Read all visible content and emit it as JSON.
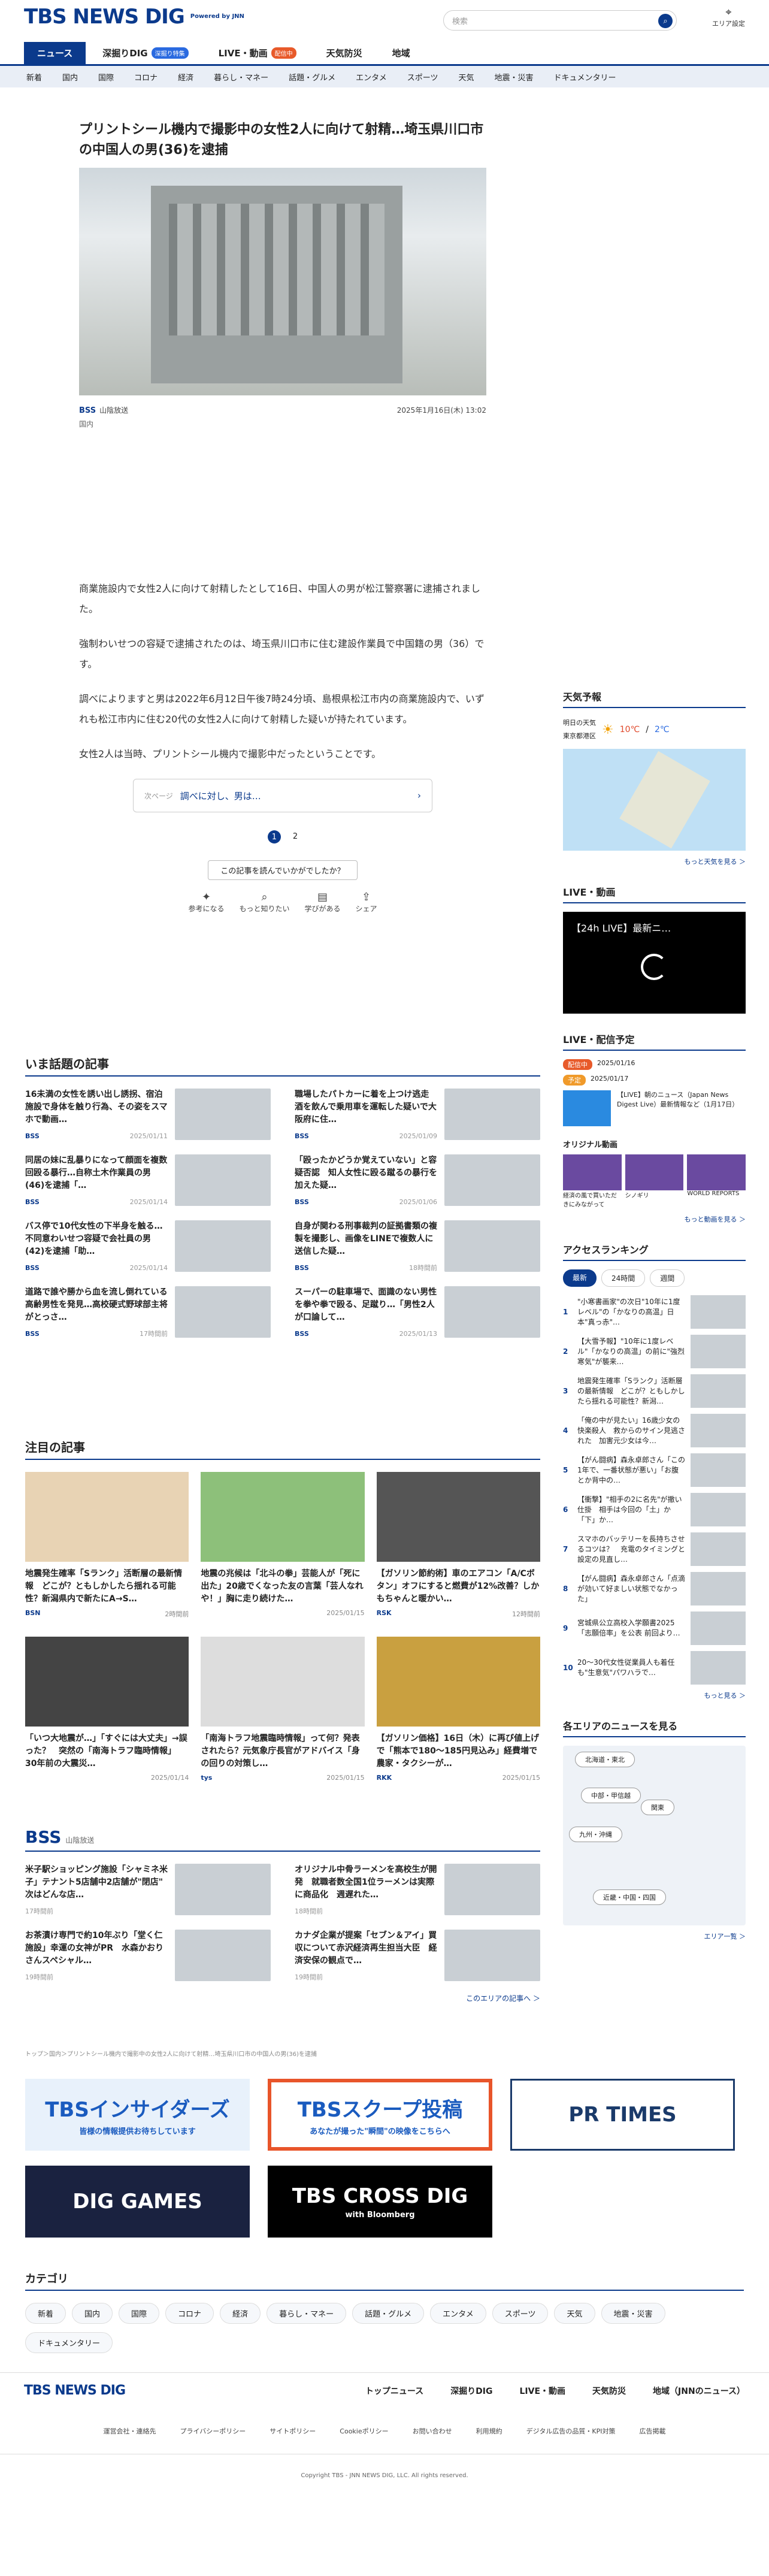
{
  "header": {
    "logo": "TBS NEWS DIG",
    "powered": "Powered by JNN",
    "search_placeholder": "検索",
    "area_label": "エリア設定"
  },
  "mainnav": [
    {
      "label": "ニュース",
      "badge": ""
    },
    {
      "label": "深掘りDIG",
      "badge": "深掘り特集"
    },
    {
      "label": "LIVE・動画",
      "badge": "配信中"
    },
    {
      "label": "天気防災",
      "badge": ""
    },
    {
      "label": "地域",
      "badge": ""
    }
  ],
  "subnav": [
    "新着",
    "国内",
    "国際",
    "コロナ",
    "経済",
    "暮らし・マネー",
    "話題・グルメ",
    "エンタメ",
    "スポーツ",
    "天気",
    "地震・災害",
    "ドキュメンタリー"
  ],
  "article": {
    "title": "プリントシール機内で撮影中の女性2人に向けて射精…埼玉県川口市の中国人の男(36)を逮捕",
    "source": "BSS",
    "source_name": "山陰放送",
    "date": "2025年1月16日(木) 13:02",
    "category": "国内",
    "paragraphs": [
      "商業施設内で女性2人に向けて射精したとして16日、中国人の男が松江警察署に逮捕されました。",
      "強制わいせつの容疑で逮捕されたのは、埼玉県川口市に住む建設作業員で中国籍の男（36）です。",
      "調べによりますと男は2022年6月12日午後7時24分頃、島根県松江市内の商業施設内で、いずれも松江市内に住む20代の女性2人に向けて射精した疑いが持たれています。",
      "女性2人は当時、プリントシール機内で撮影中だったということです。"
    ],
    "next_label": "次ページ",
    "next_text": "調べに対し、男は…",
    "pages": [
      "1",
      "2"
    ]
  },
  "feedback": {
    "question": "この記事を読んでいかがでしたか？",
    "options": [
      "参考になる",
      "もっと知りたい",
      "学びがある",
      "シェア"
    ]
  },
  "hot": {
    "heading": "いま話題の記事",
    "items": [
      {
        "title": "16未満の女性を誘い出し誘拐、宿泊施設で身体を触り行為、その姿をスマホで動画…",
        "src": "BSS",
        "date": "2025/01/11"
      },
      {
        "title": "職場したパトカーに着を上つけ逃走　酒を飲んで乗用車を運転した疑いで大阪府に住…",
        "src": "BSS",
        "date": "2025/01/09"
      },
      {
        "title": "同居の妹に乱暴りになって顔面を複数回殴る暴行…自称土木作業員の男(46)を逮捕「…",
        "src": "BSS",
        "date": "2025/01/14"
      },
      {
        "title": "「殴ったかどうか覚えていない」と容疑否認　知人女性に殴る蹴るの暴行を加えた疑…",
        "src": "BSS",
        "date": "2025/01/06"
      },
      {
        "title": "バス停で10代女性の下半身を触る…不同意わいせつ容疑で会社員の男(42)を逮捕「助…",
        "src": "BSS",
        "date": "2025/01/14"
      },
      {
        "title": "自身が関わる刑事裁判の証拠書類の複製を撮影し、画像をLINEで複数人に送信した疑…",
        "src": "BSS",
        "date": "18時間前"
      },
      {
        "title": "道路で誰や勝から血を流し倒れている高齢男性を発見…高校硬式野球部主将がとっさ…",
        "src": "BSS",
        "date": "17時間前"
      },
      {
        "title": "スーパーの駐車場で、面識のない男性を拳や拳で殴る、足蹴り…「男性2人が口論して…",
        "src": "BSS",
        "date": "2025/01/13"
      }
    ]
  },
  "featured": {
    "heading": "注目の記事",
    "items": [
      {
        "title": "地震発生確率「Sランク」活断層の最新情報　どこが？ともしかしたら揺れる可能性？新潟県内で新たにA→S…",
        "src": "BSN",
        "date": "2時間前"
      },
      {
        "title": "地震の兆候は「北斗の拳」芸能人が「死に出た」20歳でくなった友の言葉「芸人なれや！」胸に走り続けた…",
        "src": "",
        "date": "2025/01/15"
      },
      {
        "title": "【ガソリン節約術】車のエアコン「A/Cボタン」オフにすると燃費が12%改善？しかもちゃんと暖かい…",
        "src": "RSK",
        "date": "12時間前"
      },
      {
        "title": "「いつ大地震が…」「すぐには大丈夫」→誤った？　突然の「南海トラフ臨時情報」　30年前の大震災…",
        "src": "",
        "date": "2025/01/14"
      },
      {
        "title": "「南海トラフ地震臨時情報」って何？発表されたら？元気象庁長官がアドバイス「身の回りの対策し…",
        "src": "tys",
        "date": "2025/01/15"
      },
      {
        "title": "【ガソリン価格】16日（木）に再び値上げで「熊本で180～185円見込み」経費増で農家・タクシーが…",
        "src": "RKK",
        "date": "2025/01/15"
      }
    ]
  },
  "local": {
    "station": "BSS",
    "station_name": "山陰放送",
    "items": [
      {
        "title": "米子駅ショッピング施設「シャミネ米子」テナント5店舗中2店舗が\"閉店\"　次はどんな店…",
        "date": "17時間前"
      },
      {
        "title": "オリジナル中骨ラーメンを高校生が開発　就職者数全国1位ラーメンは実際に商品化　週遅れた…",
        "date": "18時間前"
      },
      {
        "title": "お茶漬け専門で約10年ぶり「堂く仁施設」幸運の女神がPR　水森かおりさんスペシャル…",
        "date": "19時間前"
      },
      {
        "title": "カナダ企業が提案「セブン＆アイ」買収について赤沢経済再生担当大臣　経済安保の観点で…",
        "date": "19時間前"
      }
    ],
    "more": "このエリアの記事へ ＞"
  },
  "breadcrumb": "トップ＞国内＞プリントシール機内で撮影中の女性2人に向けて射精…埼玉県川口市の中国人の男(36)を逮捕",
  "banners": [
    {
      "text": "TBSインサイダーズ",
      "sub": "皆様の情報提供お待ちしています"
    },
    {
      "text": "TBSスクープ投稿",
      "sub": "あなたが撮った\"瞬間\"の映像をこちらへ"
    },
    {
      "text": "PR TIMES",
      "sub": ""
    },
    {
      "text": "DIG GAMES",
      "sub": ""
    },
    {
      "text": "TBS CROSS DIG",
      "sub": "with Bloomberg"
    }
  ],
  "categories": {
    "heading": "カテゴリ",
    "items": [
      "新着",
      "国内",
      "国際",
      "コロナ",
      "経済",
      "暮らし・マネー",
      "話題・グルメ",
      "エンタメ",
      "スポーツ",
      "天気",
      "地震・災害",
      "ドキュメンタリー"
    ]
  },
  "side": {
    "weather": {
      "heading": "天気予報",
      "tomorrow": "明日の天気",
      "region": "東京都港区",
      "temp_hi": "10℃",
      "temp_lo": "2℃",
      "more": "もっと天気を見る ＞"
    },
    "live": {
      "heading": "LIVE・動画",
      "video_title": "【24h LIVE】最新ニ…"
    },
    "schedule": {
      "heading": "LIVE・配信予定",
      "tag1": "配信中",
      "date1": "2025/01/16",
      "tag2": "予定",
      "date2": "2025/01/17",
      "item": "【LIVE】朝のニュース（Japan News Digest Live）最新情報など（1月17日）"
    },
    "original": {
      "heading": "オリジナル動画",
      "items": [
        "経済の風で買いただきにみながって",
        "シノギリ",
        "WORLD REPORTS"
      ],
      "more": "もっと動画を見る ＞"
    },
    "ranking": {
      "heading": "アクセスランキング",
      "tabs": [
        "最新",
        "24時間",
        "週間"
      ],
      "items": [
        "\"小寒書画家\"の次日\"10年に1度レベル\"の「かなりの高温」日本\"真っ赤\"…",
        "【大雪予報】\"10年に1度レベル\"「かなりの高温」の前に\"強烈寒気\"が襲来…",
        "地震発生確率「Sランク」活断層の最新情報　どこが？ともしかしたら揺れる可能性？新潟…",
        "「俺の中が見たい」16歳少女の快楽殺人　救からのサイン見逃された　加害元少女は今…",
        "【がん闘病】森永卓郎さん「この1年で、一番状態が悪い」「お腹とか背中の…",
        "【衝撃】\"相手の2に名先\"が撤い仕掛　相手は今回の「土」か「下」か…",
        "スマホのバッテリーを長持ちさせるコツは？　充電のタイミングと設定の見直し…",
        "【がん闘病】森永卓郎さん「点滴が効いて好ましい状態でなかった」",
        "宮城県公立高校入学願書2025「志願倍率」を公表 前回より…",
        "20～30代女性従業員人も着任も\"生意気\"パワハラで…"
      ],
      "more": "もっと見る ＞"
    },
    "area": {
      "heading": "各エリアのニュースを見る",
      "regions": [
        "北海道・東北",
        "中部・甲信越",
        "関東",
        "九州・沖縄",
        "近畿・中国・四国"
      ],
      "more": "エリア一覧 ＞"
    }
  },
  "footer": {
    "links": [
      "トップニュース",
      "深掘りDIG",
      "LIVE・動画",
      "天気防災",
      "地域（JNNのニュース）"
    ],
    "sub": [
      "運営会社・連絡先",
      "プライバシーポリシー",
      "サイトポリシー",
      "Cookieポリシー",
      "お問い合わせ",
      "利用規約",
      "デジタル広告の品質・KPI対策",
      "広告掲載"
    ],
    "copyright": "Copyright TBS - JNN NEWS DIG, LLC. All rights reserved."
  }
}
